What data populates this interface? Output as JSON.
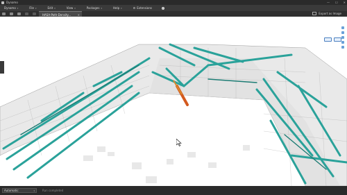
{
  "window": {
    "title": "Dynamo",
    "min": "—",
    "max": "☐",
    "close": "✕"
  },
  "menu": {
    "items": [
      "Dynamo",
      "File",
      "Edit",
      "View",
      "Packages",
      "Help"
    ],
    "extensions": "Extensions"
  },
  "tabbar": {
    "tab_label": "HASA-Path-Density...",
    "tab_close": "✕",
    "export_label": "Export as Image"
  },
  "status": {
    "run_mode": "Automatic",
    "run_status": "Run completed"
  },
  "colors": {
    "pipe": "#2aa29a",
    "pipe_dark": "#1c7c74",
    "hot": "#d35a1f",
    "grid": "#b9b9b9"
  }
}
